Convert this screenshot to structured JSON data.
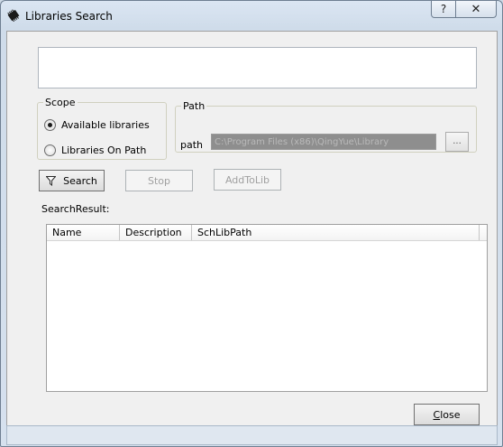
{
  "window": {
    "title": "Libraries Search",
    "help_glyph": "?",
    "close_glyph": "✕"
  },
  "search": {
    "query": ""
  },
  "scope": {
    "legend": "Scope",
    "options": [
      {
        "label": "Available libraries",
        "checked": true
      },
      {
        "label": "Libraries On Path",
        "checked": false
      }
    ]
  },
  "path": {
    "legend": "Path",
    "label": "path",
    "value": "C:\\Program Files (x86)\\QingYue\\Library",
    "browse_label": "..."
  },
  "buttons": {
    "search": "Search",
    "stop": "Stop",
    "add_to_lib": "AddToLib",
    "close_first": "C",
    "close_rest": "lose"
  },
  "results": {
    "label": "SearchResult:",
    "columns": [
      "Name",
      "Description",
      "SchLibPath"
    ],
    "rows": []
  },
  "icons": {
    "app": "chip-icon",
    "search": "filter-icon"
  }
}
